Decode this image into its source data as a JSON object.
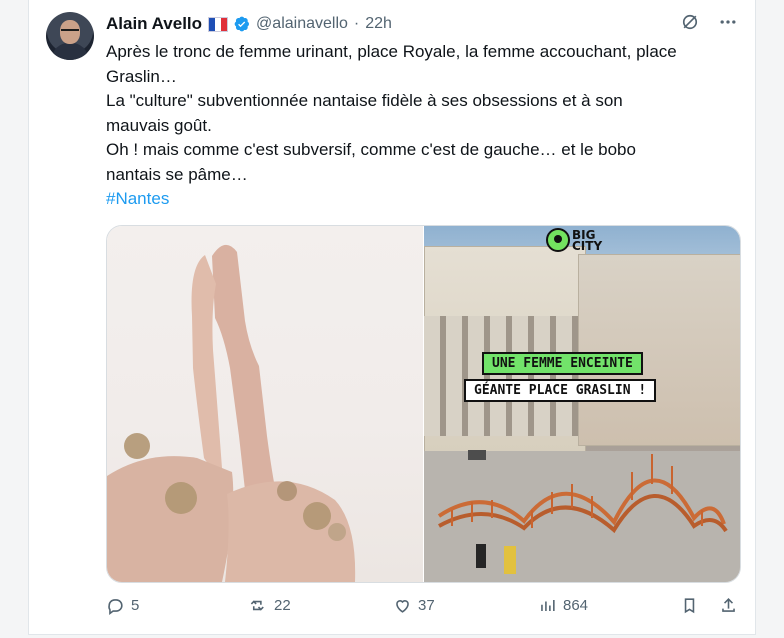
{
  "tweet": {
    "author_name": "Alain Avello",
    "handle": "@alainavello",
    "separator": "·",
    "time": "22h",
    "text_lines": [
      "Après le tronc de femme urinant, place Royale, la femme accouchant, place",
      "Graslin…",
      "La \"culture\" subventionnée nantaise fidèle à ses obsessions et à son",
      "mauvais goût.",
      "Oh ! mais comme c'est subversif, comme c'est de gauche… et le bobo",
      "nantais se pâme…"
    ],
    "hashtag": "#Nantes",
    "media": {
      "right_overlay_line1": "UNE FEMME ENCEINTE",
      "right_overlay_line2": "GÉANTE PLACE GRASLIN !",
      "logo_text": "BIG CITY"
    },
    "actions": {
      "replies": "5",
      "reposts": "22",
      "likes": "37",
      "views": "864"
    }
  },
  "colors": {
    "accent": "#1d9bf0",
    "text": "#0f1419",
    "muted": "#536471",
    "green_tag": "#72e36a"
  },
  "icons": [
    "verified-badge-icon",
    "grok-icon",
    "more-icon",
    "reply-icon",
    "repost-icon",
    "like-icon",
    "views-icon",
    "bookmark-icon",
    "share-icon"
  ]
}
